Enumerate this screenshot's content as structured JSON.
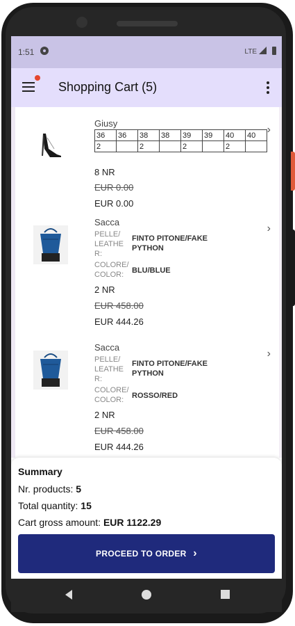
{
  "status": {
    "time": "1:51",
    "network": "LTE"
  },
  "appbar": {
    "title": "Shopping Cart (5)"
  },
  "items": [
    {
      "name": "Giusy",
      "sizes": [
        "36",
        "36",
        "38",
        "38",
        "39",
        "39",
        "40",
        "40"
      ],
      "qtys": [
        "2",
        "",
        "2",
        "",
        "2",
        "",
        "2",
        ""
      ],
      "qty_label": "8 NR",
      "old_price": "EUR 0.00",
      "price": "EUR 0.00"
    },
    {
      "name": "Sacca",
      "attr1_key": "PELLE/ LEATHE R:",
      "attr1_val": "FINTO PITONE/FAKE PYTHON",
      "attr2_key": "COLORE/ COLOR:",
      "attr2_val": "BLU/BLUE",
      "qty_label": "2 NR",
      "old_price": "EUR 458.00",
      "price": "EUR 444.26"
    },
    {
      "name": "Sacca",
      "attr1_key": "PELLE/ LEATHE R:",
      "attr1_val": "FINTO PITONE/FAKE PYTHON",
      "attr2_key": "COLORE/ COLOR:",
      "attr2_val": "ROSSO/RED",
      "qty_label": "2 NR",
      "old_price": "EUR 458.00",
      "price": "EUR 444.26"
    }
  ],
  "summary": {
    "title": "Summary",
    "products_label": "Nr. products:",
    "products_value": "5",
    "quantity_label": "Total quantity:",
    "quantity_value": "15",
    "amount_label": "Cart gross amount:",
    "amount_value": "EUR 1122.29",
    "button_label": "PROCEED TO ORDER"
  }
}
